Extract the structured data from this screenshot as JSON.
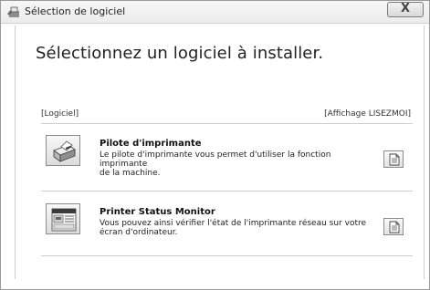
{
  "window": {
    "title": "Sélection de logiciel",
    "close_label": "X"
  },
  "main": {
    "heading": "Sélectionnez un logiciel à installer.",
    "section_label": "[Logiciel]",
    "readme_label": "[Affichage LISEZMOI]"
  },
  "items": [
    {
      "title": "Pilote d'imprimante",
      "desc_line1": "Le pilote d'imprimante vous permet d'utiliser la fonction imprimante",
      "desc_line2": "de la machine.",
      "icon": "printer-icon",
      "readme_icon": "document-icon"
    },
    {
      "title": "Printer Status Monitor",
      "desc_line1": "Vous pouvez ainsi vérifier l'état de l'imprimante réseau sur votre",
      "desc_line2": "écran d'ordinateur.",
      "icon": "status-monitor-icon",
      "readme_icon": "document-icon"
    }
  ],
  "colors": {
    "window_border": "#9a9a9a",
    "divider": "#cfcfcf"
  }
}
